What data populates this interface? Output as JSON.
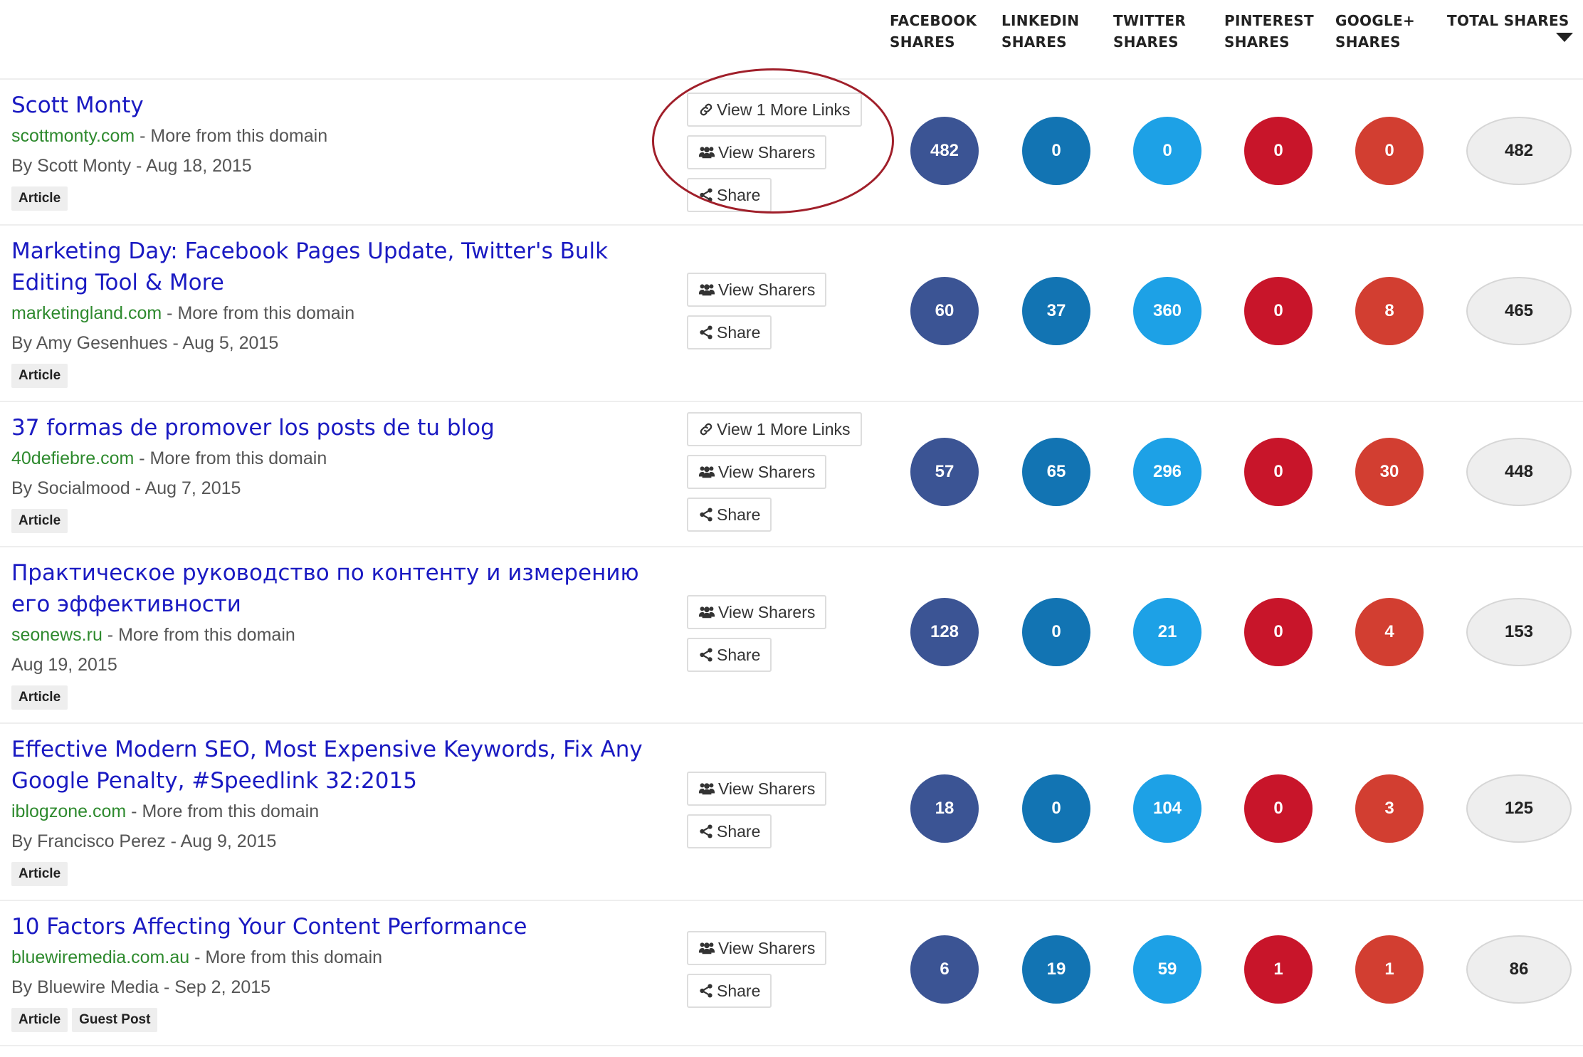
{
  "columns": [
    {
      "line1": "FACEBOOK",
      "line2": "SHARES"
    },
    {
      "line1": "LINKEDIN",
      "line2": "SHARES"
    },
    {
      "line1": "TWITTER",
      "line2": "SHARES"
    },
    {
      "line1": "PINTEREST",
      "line2": "SHARES"
    },
    {
      "line1": "GOOGLE+",
      "line2": "SHARES"
    },
    {
      "line1": "TOTAL SHARES",
      "line2": ""
    }
  ],
  "colors": {
    "facebook": "#3b5494",
    "linkedin": "#1274b3",
    "twitter": "#1da1e6",
    "pinterest": "#c8152a",
    "googleplus": "#d23e31",
    "title_link": "#1a1ac2",
    "domain_link": "#2e8a2e",
    "annotation": "#a01f2a"
  },
  "labels": {
    "more_from_domain": "More from this domain",
    "view_more_links": "View 1 More Links",
    "view_sharers": "View Sharers",
    "share": "Share",
    "separator": " - "
  },
  "rows": [
    {
      "title": "Scott Monty",
      "domain": "scottmonty.com",
      "byline": "By Scott Monty - Aug 18, 2015",
      "tags": [
        "Article"
      ],
      "has_more_links": true,
      "shares": {
        "facebook": "482",
        "linkedin": "0",
        "twitter": "0",
        "pinterest": "0",
        "googleplus": "0",
        "total": "482"
      }
    },
    {
      "title": "Marketing Day: Facebook Pages Update, Twitter's Bulk Editing Tool & More",
      "domain": "marketingland.com",
      "byline": "By Amy Gesenhues - Aug 5, 2015",
      "tags": [
        "Article"
      ],
      "has_more_links": false,
      "shares": {
        "facebook": "60",
        "linkedin": "37",
        "twitter": "360",
        "pinterest": "0",
        "googleplus": "8",
        "total": "465"
      }
    },
    {
      "title": "37 formas de promover los posts de tu blog",
      "domain": "40defiebre.com",
      "byline": "By Socialmood - Aug 7, 2015",
      "tags": [
        "Article"
      ],
      "has_more_links": true,
      "shares": {
        "facebook": "57",
        "linkedin": "65",
        "twitter": "296",
        "pinterest": "0",
        "googleplus": "30",
        "total": "448"
      }
    },
    {
      "title": "Практическое руководство по контенту и измерению его эффективности",
      "domain": "seonews.ru",
      "byline": "Aug 19, 2015",
      "tags": [
        "Article"
      ],
      "has_more_links": false,
      "shares": {
        "facebook": "128",
        "linkedin": "0",
        "twitter": "21",
        "pinterest": "0",
        "googleplus": "4",
        "total": "153"
      }
    },
    {
      "title": "Effective Modern SEO, Most Expensive Keywords, Fix Any Google Penalty, #Speedlink 32:2015",
      "domain": "iblogzone.com",
      "byline": "By Francisco Perez - Aug 9, 2015",
      "tags": [
        "Article"
      ],
      "has_more_links": false,
      "shares": {
        "facebook": "18",
        "linkedin": "0",
        "twitter": "104",
        "pinterest": "0",
        "googleplus": "3",
        "total": "125"
      }
    },
    {
      "title": "10 Factors Affecting Your Content Performance",
      "domain": "bluewiremedia.com.au",
      "byline": "By Bluewire Media - Sep 2, 2015",
      "tags": [
        "Article",
        "Guest Post"
      ],
      "has_more_links": false,
      "shares": {
        "facebook": "6",
        "linkedin": "19",
        "twitter": "59",
        "pinterest": "1",
        "googleplus": "1",
        "total": "86"
      }
    }
  ]
}
